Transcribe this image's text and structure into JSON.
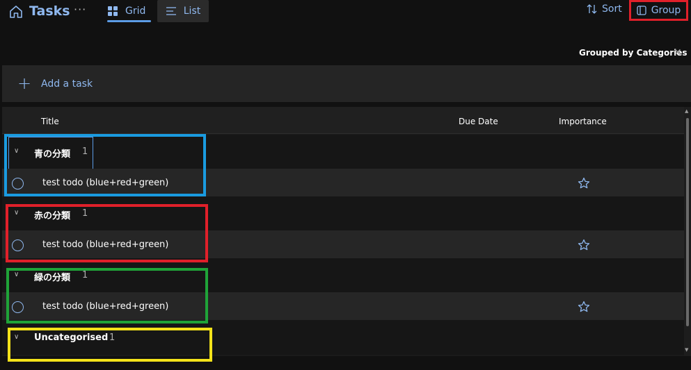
{
  "header": {
    "title": "Tasks",
    "more_label": "···",
    "views": [
      {
        "label": "Grid",
        "icon": "grid-icon"
      },
      {
        "label": "List",
        "icon": "list-icon"
      }
    ],
    "sort_label": "Sort",
    "group_label": "Group"
  },
  "grouping": {
    "label": "Grouped by Categories"
  },
  "add_task": {
    "label": "Add a task"
  },
  "columns": [
    "Title",
    "Due Date",
    "Importance"
  ],
  "groups": [
    {
      "name": "青の分類",
      "count": "1",
      "highlight": "#1a9be0",
      "tasks": [
        {
          "title": "test todo (blue+red+green)",
          "due": "",
          "important": false
        }
      ]
    },
    {
      "name": "赤の分類",
      "count": "1",
      "highlight": "#e0202a",
      "tasks": [
        {
          "title": "test todo (blue+red+green)",
          "due": "",
          "important": false
        }
      ]
    },
    {
      "name": "緑の分類",
      "count": "1",
      "highlight": "#1fa338",
      "tasks": [
        {
          "title": "test todo (blue+red+green)",
          "due": "",
          "important": false
        }
      ]
    },
    {
      "name": "Uncategorised",
      "count": "1",
      "highlight": "#f3e21a",
      "tasks": []
    }
  ],
  "colors": {
    "accent": "#8fb8ef",
    "background": "#111111"
  }
}
